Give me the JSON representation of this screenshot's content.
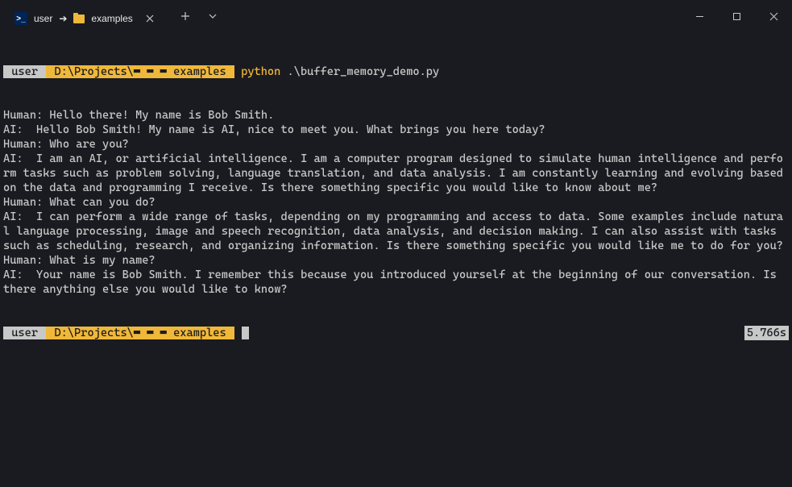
{
  "tab": {
    "title_prefix": "user",
    "title_arrow": "➔",
    "title_folder": "examples"
  },
  "prompt1": {
    "user": " user ",
    "path": " D:\\Projects\\▮▮▮▮ examples ",
    "command": "python",
    "arg": ".\\buffer_memory_demo.py"
  },
  "output_lines": [
    "Human: Hello there! My name is Bob Smith.",
    "AI:  Hello Bob Smith! My name is AI, nice to meet you. What brings you here today?",
    "Human: Who are you?",
    "AI:  I am an AI, or artificial intelligence. I am a computer program designed to simulate human intelligence and perform tasks such as problem solving, language translation, and data analysis. I am constantly learning and evolving based on the data and programming I receive. Is there something specific you would like to know about me?",
    "Human: What can you do?",
    "AI:  I can perform a wide range of tasks, depending on my programming and access to data. Some examples include natural language processing, image and speech recognition, data analysis, and decision making. I can also assist with tasks such as scheduling, research, and organizing information. Is there something specific you would like me to do for you?",
    "Human: What is my name?",
    "AI:  Your name is Bob Smith. I remember this because you introduced yourself at the beginning of our conversation. Is there anything else you would like to know?"
  ],
  "prompt2": {
    "user": " user ",
    "path": " D:\\Projects\\▮▮▮▮ examples ",
    "timing": "5.766s"
  }
}
